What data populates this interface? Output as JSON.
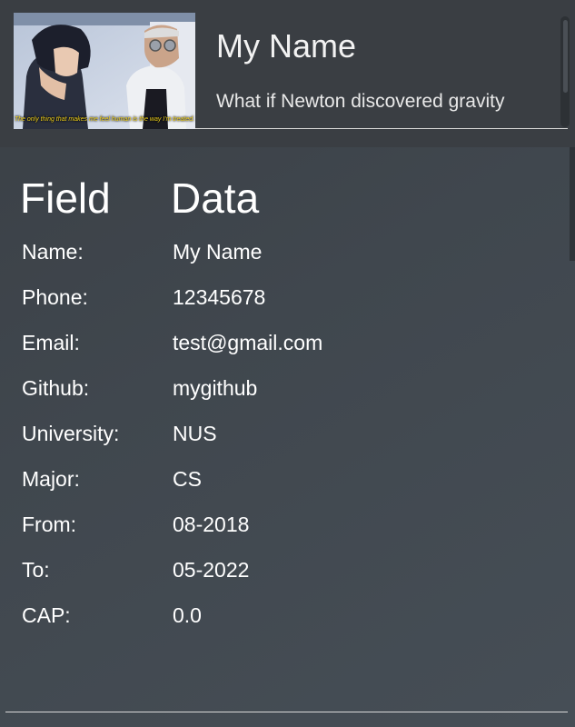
{
  "header": {
    "image_caption": "The only thing that makes me feel human is the way I'm treated.",
    "name": "My Name",
    "tagline": "What if Newton discovered gravity"
  },
  "table": {
    "headers": [
      "Field",
      "Data"
    ],
    "rows": [
      {
        "label": "Name:",
        "value": "My Name"
      },
      {
        "label": "Phone:",
        "value": "12345678"
      },
      {
        "label": "Email:",
        "value": "test@gmail.com"
      },
      {
        "label": "Github:",
        "value": "mygithub"
      },
      {
        "label": "University:",
        "value": "NUS"
      },
      {
        "label": "Major:",
        "value": "CS"
      },
      {
        "label": "From:",
        "value": "08-2018"
      },
      {
        "label": "To:",
        "value": "05-2022"
      },
      {
        "label": "CAP:",
        "value": "0.0"
      }
    ]
  }
}
